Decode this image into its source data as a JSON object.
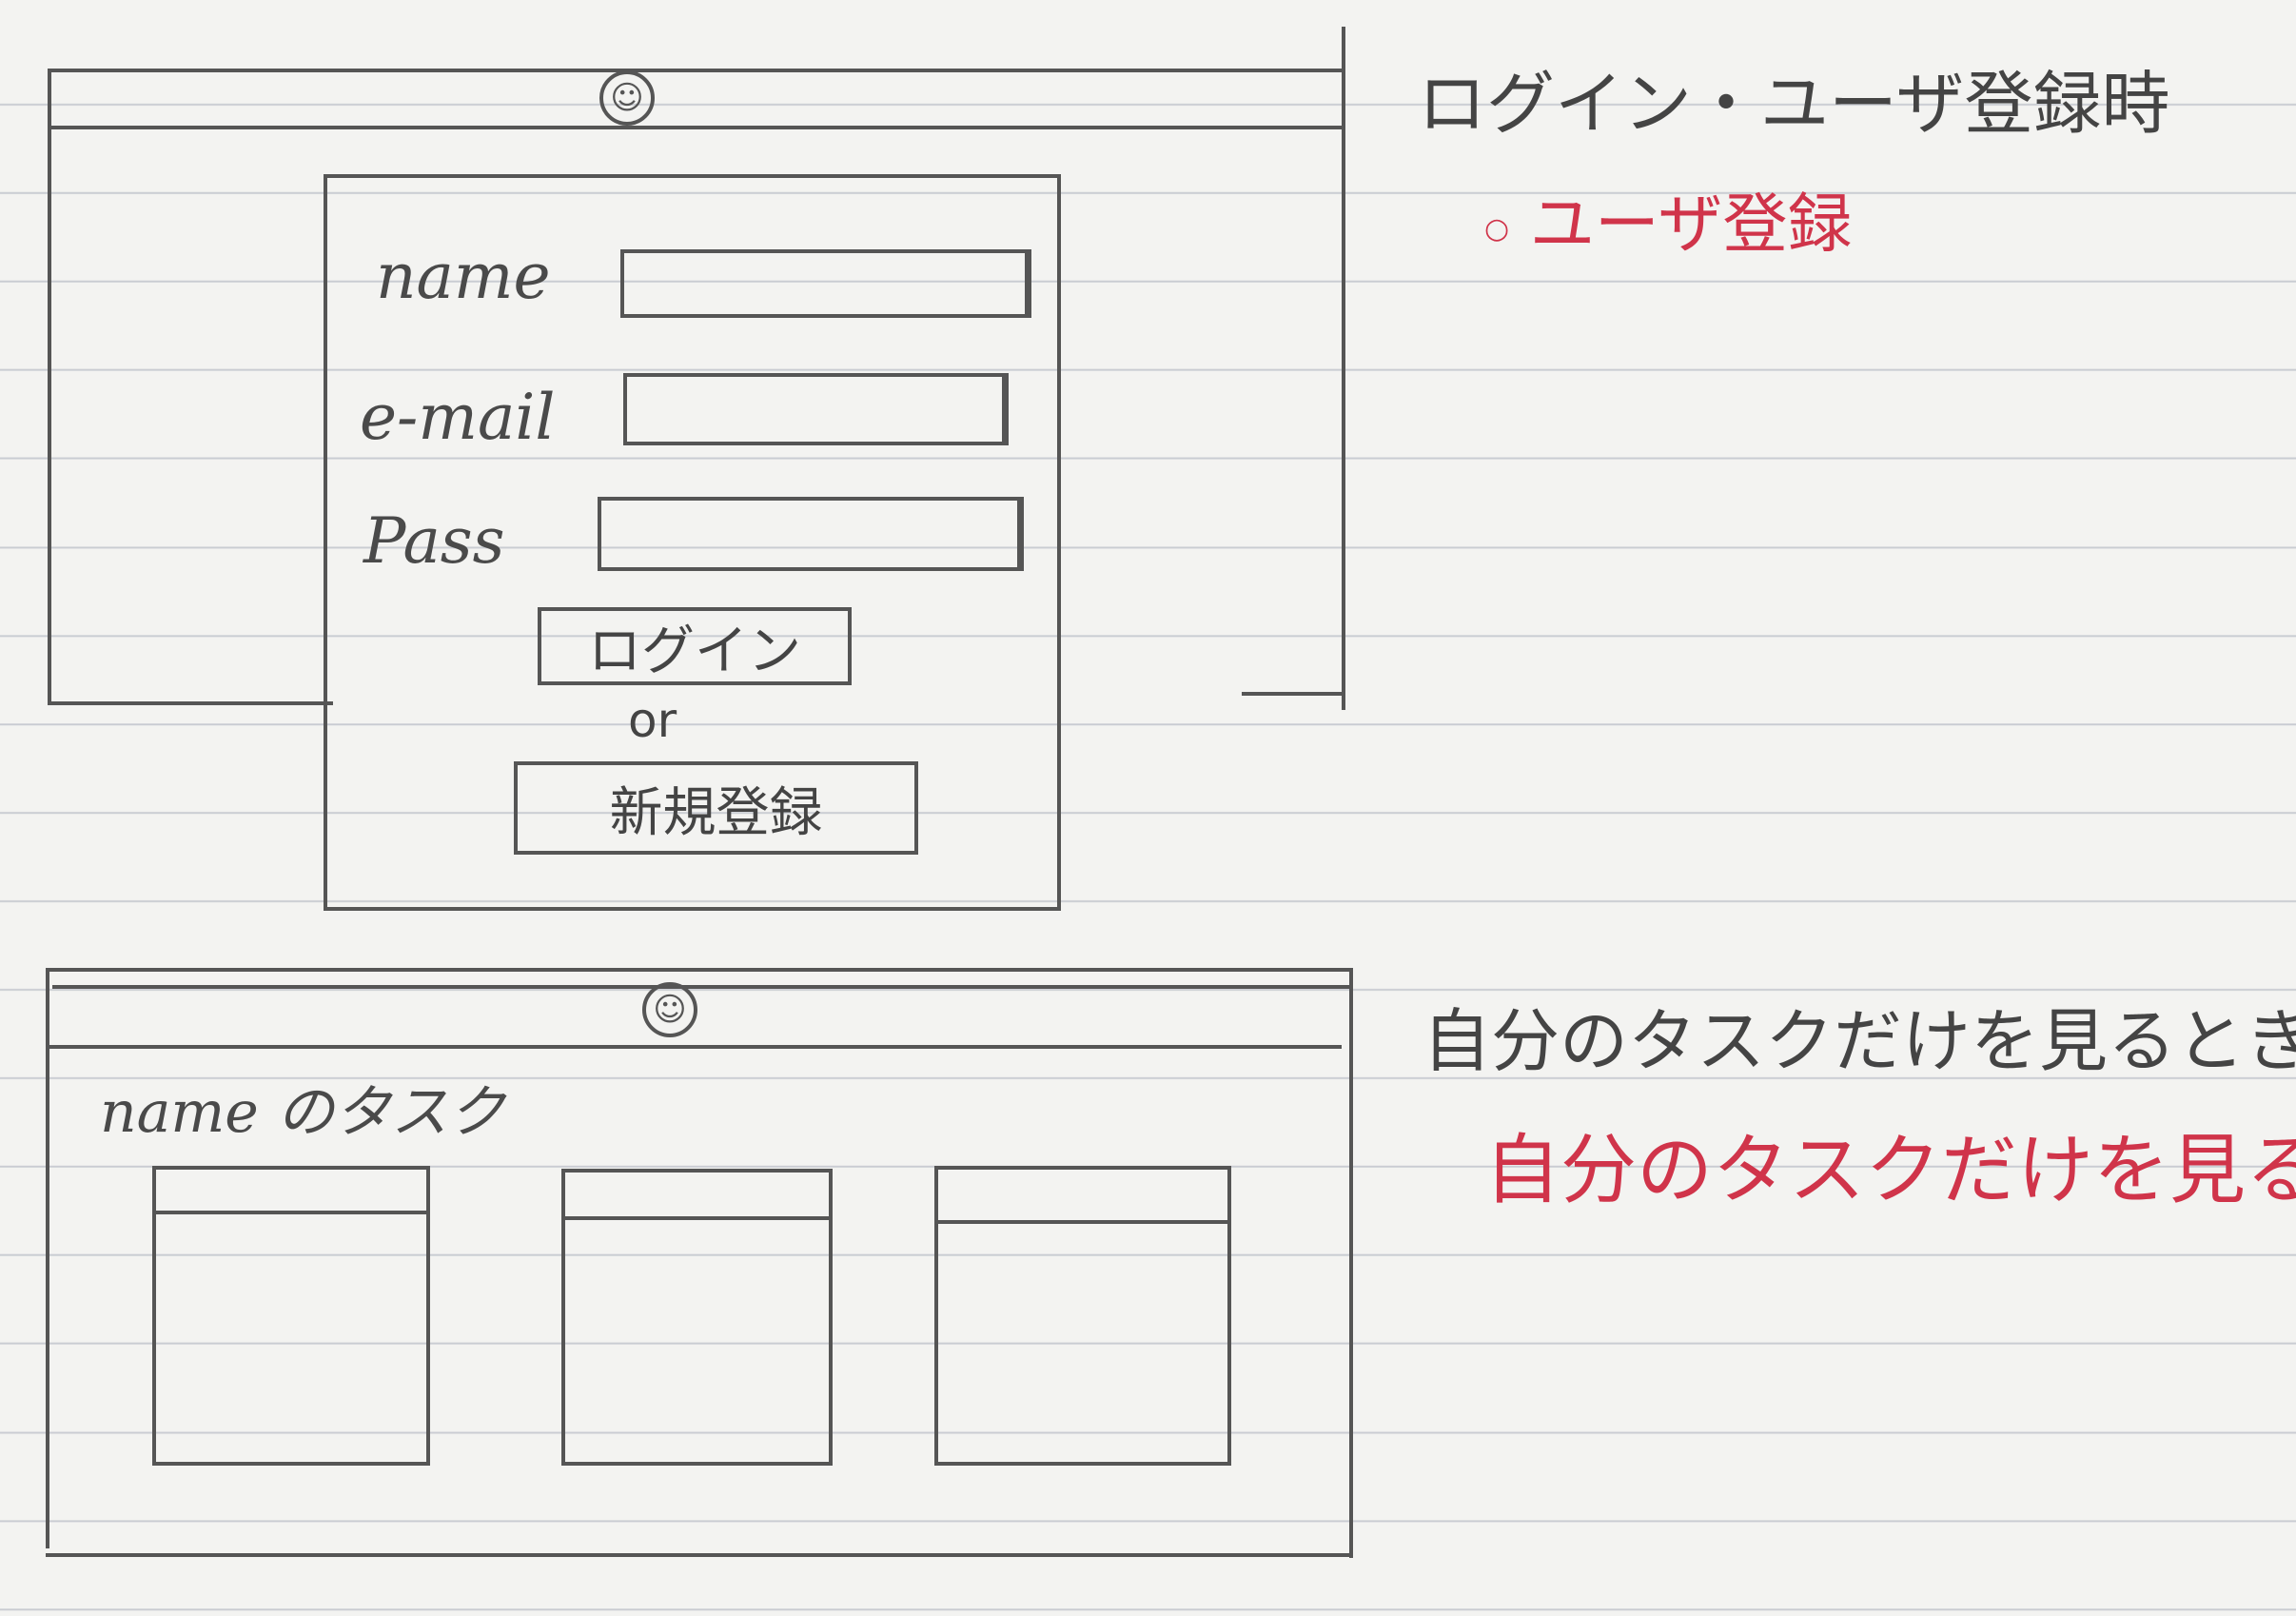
{
  "screen1": {
    "note": "ログイン・ユーザ登録時",
    "red_note": "ユーザ登録",
    "avatar_icon": "user-avatar-icon",
    "fields": [
      {
        "label": "name"
      },
      {
        "label": "e-mail"
      },
      {
        "label": "Pass"
      }
    ],
    "login_button": "ログイン",
    "or_text": "or",
    "register_button": "新規登録"
  },
  "screen2": {
    "note": "自分のタスクだけを見るとき",
    "red_note": "自分のタスクだけを見る",
    "avatar_icon": "user-avatar-icon",
    "heading": "name のタスク"
  },
  "colors": {
    "pencil": "#555555",
    "red_pen": "#d0344a",
    "paper": "#f3f3f1",
    "rule": "#c9ccd2"
  }
}
